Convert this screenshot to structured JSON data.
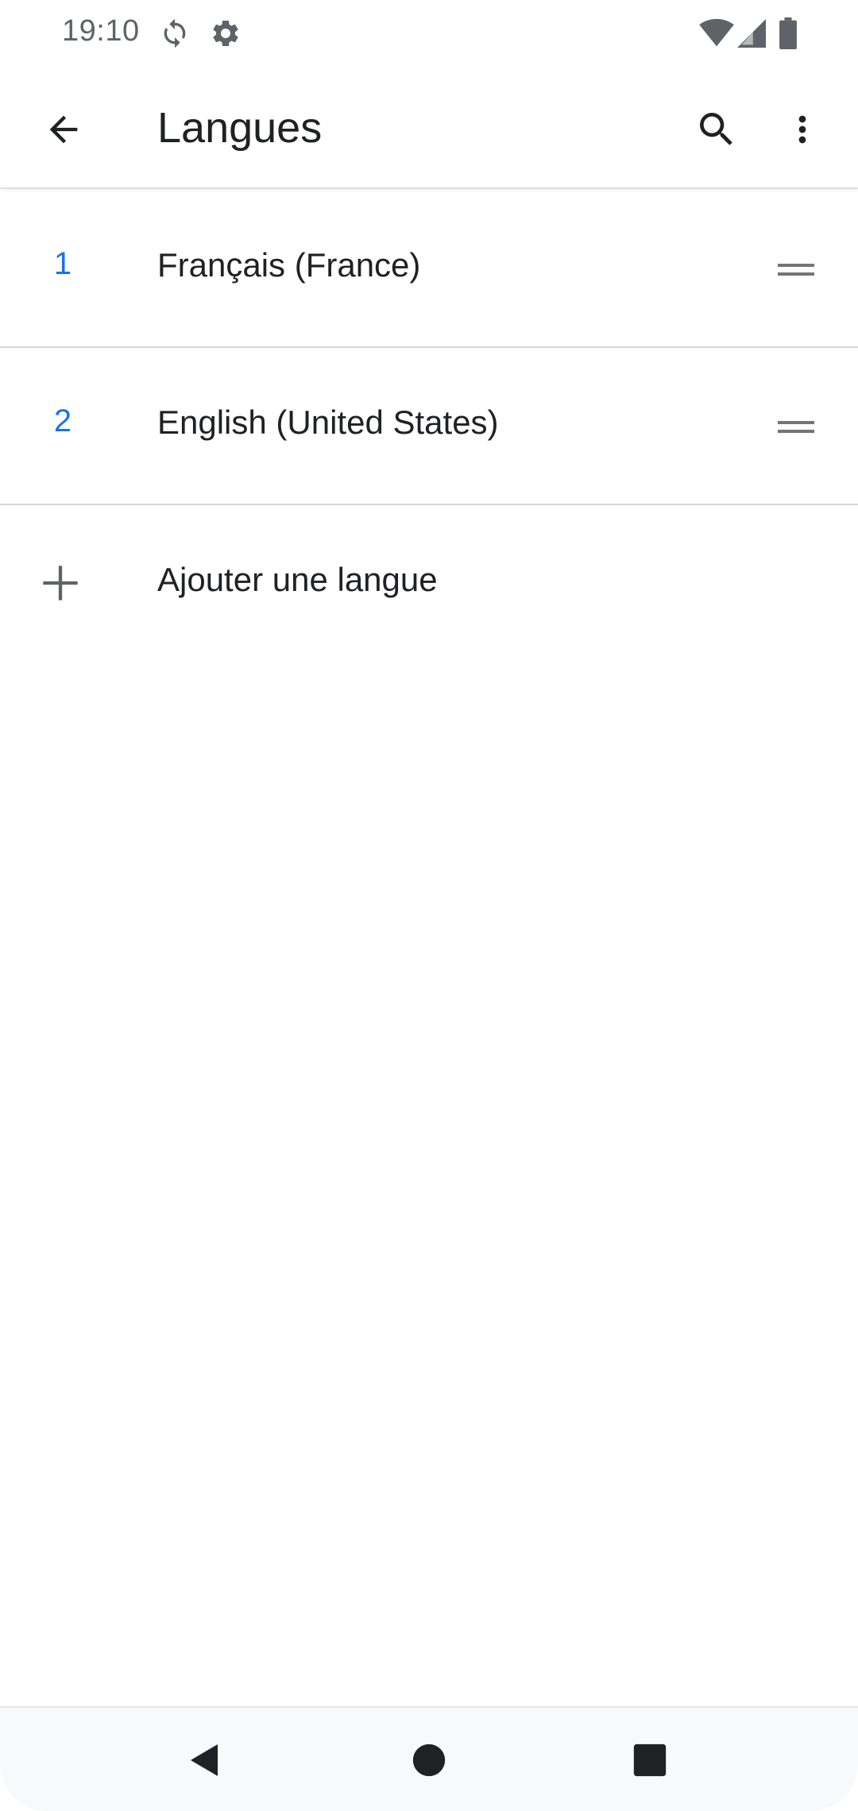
{
  "status_bar": {
    "time": "19:10",
    "icons": [
      "sync-icon",
      "settings-gear-icon",
      "wifi-icon",
      "cell-signal-icon",
      "battery-icon"
    ]
  },
  "app_bar": {
    "title": "Langues",
    "back_icon": "arrow-back-icon",
    "search_icon": "search-icon",
    "more_icon": "more-vert-icon"
  },
  "languages": [
    {
      "index": "1",
      "name": "Français (France)"
    },
    {
      "index": "2",
      "name": "English (United States)"
    }
  ],
  "add_language": {
    "label": "Ajouter une langue",
    "icon": "plus-icon"
  },
  "nav_bar": {
    "icons": [
      "back-triangle-icon",
      "home-circle-icon",
      "recents-square-icon"
    ]
  },
  "colors": {
    "accent": "#1a73e8",
    "text": "#202124",
    "secondary": "#5f6368",
    "divider": "#d6d6d6"
  }
}
